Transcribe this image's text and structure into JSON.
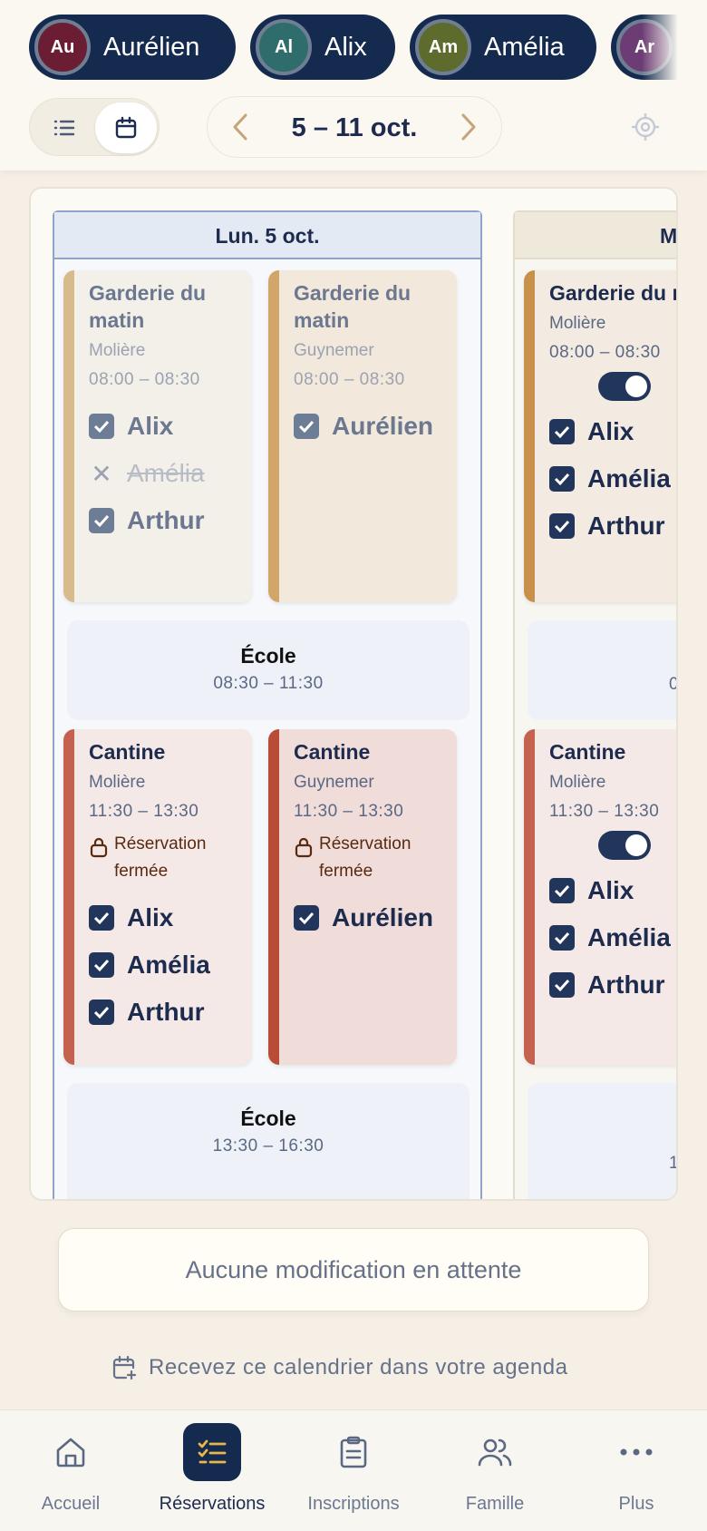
{
  "children_chips": [
    {
      "initials": "Au",
      "name": "Aurélien",
      "color": "#6b1d33"
    },
    {
      "initials": "Al",
      "name": "Alix",
      "color": "#2f6d6d"
    },
    {
      "initials": "Am",
      "name": "Amélia",
      "color": "#5d6b2d"
    },
    {
      "initials": "Ar",
      "name": "",
      "color": "#6c3d74"
    }
  ],
  "toolbar": {
    "week_label": "5 – 11 oct."
  },
  "calendar": {
    "day1": {
      "header": "Lun. 5 oct.",
      "garderie_a": {
        "title": "Garderie du matin",
        "site": "Molière",
        "time": "08:00 – 08:30",
        "kids": [
          "Alix",
          "Amélia",
          "Arthur"
        ]
      },
      "garderie_b": {
        "title": "Garderie du matin",
        "site": "Guynemer",
        "time": "08:00 – 08:30",
        "kids": [
          "Aurélien"
        ]
      },
      "ecole_1": {
        "title": "École",
        "time": "08:30 – 11:30"
      },
      "cantine_a": {
        "title": "Cantine",
        "site": "Molière",
        "time": "11:30 – 13:30",
        "lock": "Réservation fermée",
        "kids": [
          "Alix",
          "Amélia",
          "Arthur"
        ]
      },
      "cantine_b": {
        "title": "Cantine",
        "site": "Guynemer",
        "time": "11:30 – 13:30",
        "lock": "Réservation fermée",
        "kids": [
          "Aurélien"
        ]
      },
      "ecole_2": {
        "title": "École",
        "time": "13:30 – 16:30"
      }
    },
    "day2": {
      "header": "M",
      "garderie": {
        "title": "Garderie du matin",
        "site": "Molière",
        "time": "08:00 – 08:30",
        "kids": [
          "Alix",
          "Amélia",
          "Arthur"
        ]
      },
      "ecole_1_time": "0",
      "cantine": {
        "title": "Cantine",
        "site": "Molière",
        "time": "11:30 – 13:30",
        "kids": [
          "Alix",
          "Amélia",
          "Arthur"
        ]
      },
      "ecole_2_time": "1"
    }
  },
  "pending_text": "Aucune modification en attente",
  "agenda_link": "Recevez ce calendrier dans votre agenda",
  "nav": [
    {
      "label": "Accueil",
      "icon": "home-icon"
    },
    {
      "label": "Réservations",
      "icon": "checklist-icon"
    },
    {
      "label": "Inscriptions",
      "icon": "clipboard-icon"
    },
    {
      "label": "Famille",
      "icon": "users-icon"
    },
    {
      "label": "Plus",
      "icon": "more-icon"
    }
  ],
  "colors": {
    "navy": "#152a4f",
    "garderie_bar": "#d2a56b",
    "cantine_bar": "#c4614f"
  }
}
